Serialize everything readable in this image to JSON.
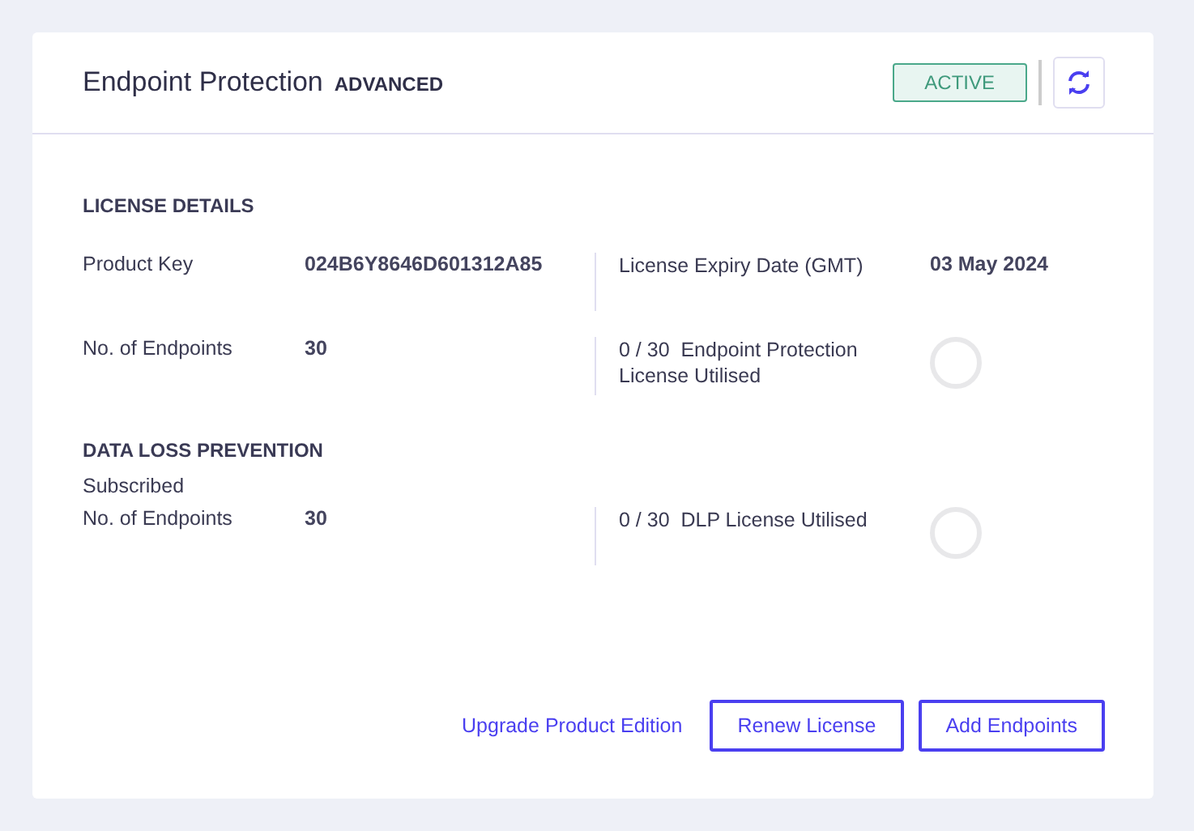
{
  "header": {
    "title": "Endpoint Protection",
    "edition": "ADVANCED",
    "status": {
      "label": "ACTIVE",
      "active": true
    }
  },
  "sections": [
    {
      "title": "LICENSE DETAILS",
      "rows": [
        {
          "label": "Product Key",
          "value": "024B6Y8646D601312A85",
          "right_label": "License Expiry Date (GMT)",
          "right_value": "03 May 2024",
          "kind": "value"
        },
        {
          "label": "No. of Endpoints",
          "value": "30",
          "right_label": "0 / 30  Endpoint Protection License Utilised",
          "level": 0,
          "kind": "ring"
        }
      ]
    },
    {
      "title": "DATA LOSS PREVENTION",
      "subtitle": "Subscribed",
      "rows": [
        {
          "label": "No. of Endpoints",
          "value": "30",
          "right_label": "0 / 30  DLP License Utilised",
          "level": 0,
          "kind": "ring"
        }
      ]
    }
  ],
  "actions": [
    {
      "label": "Upgrade Product Edition",
      "kind": "link"
    },
    {
      "label": "Renew License",
      "kind": "button"
    },
    {
      "label": "Add Endpoints",
      "kind": "button"
    }
  ]
}
